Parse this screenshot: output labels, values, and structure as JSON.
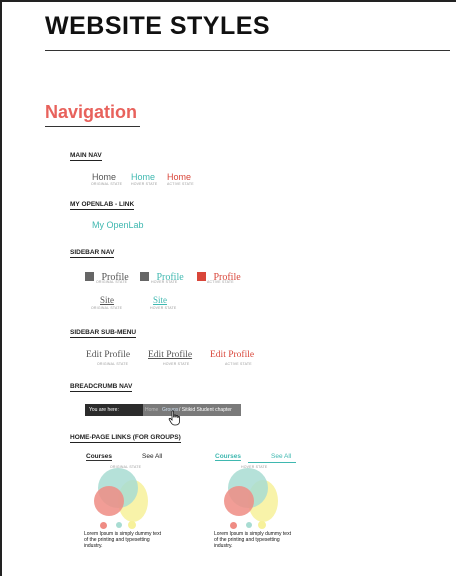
{
  "page": {
    "title": "WEBSITE STYLES",
    "section_heading": "Navigation"
  },
  "sections": {
    "main_nav": "MAIN NAV",
    "my_openlab": "MY OPENLAB - LINK",
    "sidebar_nav": "SIDEBAR NAV",
    "sidebar_submenu": "SIDEBAR SUB-MENU",
    "breadcrumb_nav": "BREADCRUMB NAV",
    "homepage_links": "HOME-PAGE LINKS (FOR GROUPS)"
  },
  "states": {
    "original": "ORIGINAL STATE",
    "hover": "HOVER STATE",
    "active": "ACTIVE STATE"
  },
  "main_nav": {
    "item_label": "Home"
  },
  "my_openlab": {
    "link_label": "My OpenLab"
  },
  "sidebar_nav": {
    "profile_label": "Profile",
    "site_label": "Site"
  },
  "sidebar_submenu": {
    "item_label": "Edit Profile"
  },
  "breadcrumb": {
    "prefix": "You are here:",
    "home": "Home",
    "middle": "Groups",
    "current": "/ Sitikid Student chapter"
  },
  "homepage_links": {
    "card_title": "Courses",
    "see_all": "See All",
    "body_text": "Lorem Ipsum is simply dummy text of the printing and typesetting industry."
  },
  "colors": {
    "accent_red": "#e8625c",
    "active_red": "#d9463a",
    "hover_teal": "#3fb8b0",
    "bubble_teal": "#a8dcd2",
    "bubble_yellow": "#f7f19a",
    "bubble_pink": "#ef8c84"
  }
}
